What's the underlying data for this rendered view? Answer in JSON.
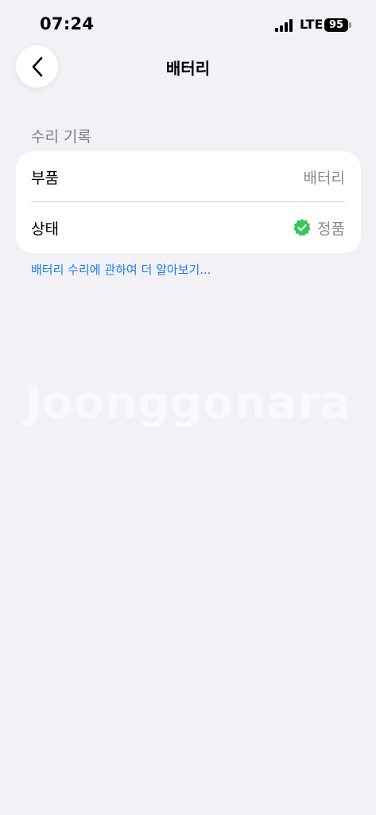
{
  "status_bar": {
    "time": "07:24",
    "network": "LTE",
    "battery": "95",
    "icons": [
      "signal-icon",
      "battery-icon"
    ]
  },
  "nav": {
    "title": "배터리",
    "back_icon": "chevron-left-icon"
  },
  "section": {
    "header": "수리 기록",
    "rows": [
      {
        "label": "부품",
        "value": "배터리"
      },
      {
        "label": "상태",
        "value": "정품",
        "icon": "verified-badge-icon",
        "icon_color": "#34c759"
      }
    ]
  },
  "learn_more": "배터리 수리에 관하여 더 알아보기...",
  "watermark": "Joonggonara",
  "colors": {
    "background": "#f2f1f6",
    "card": "#ffffff",
    "link": "#1a7df0",
    "secondary_text": "#8a8a8e",
    "verified": "#34c759"
  }
}
